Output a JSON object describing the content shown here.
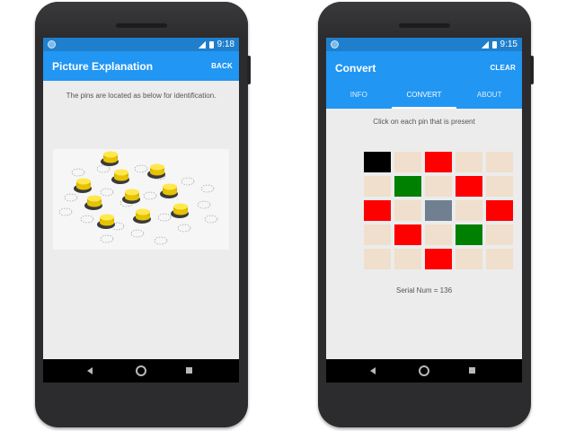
{
  "status": {
    "left_time": "9:18",
    "right_time": "9:15"
  },
  "left_screen": {
    "title": "Picture Explanation",
    "action": "BACK",
    "caption": "The pins are located as below for identification."
  },
  "right_screen": {
    "title": "Convert",
    "action": "CLEAR",
    "tabs": [
      "INFO",
      "CONVERT",
      "ABOUT"
    ],
    "active_tab": "CONVERT",
    "instruction": "Click on each pin that is present",
    "serial": "Serial Num = 136",
    "grid": [
      [
        "black",
        "off",
        "red",
        "off",
        "off"
      ],
      [
        "off",
        "green",
        "off",
        "red",
        "off"
      ],
      [
        "red",
        "off",
        "gray",
        "off",
        "red"
      ],
      [
        "off",
        "red",
        "off",
        "green",
        "off"
      ],
      [
        "off",
        "off",
        "red",
        "off",
        "off"
      ]
    ]
  },
  "colors": {
    "status_bar": "#1f7fcc",
    "app_bar": "#2196f3",
    "pin_off": "#efdfcc",
    "pin_red": "#ff0000",
    "pin_green": "#008000",
    "pin_black": "#000000",
    "pin_gray": "#708090"
  }
}
